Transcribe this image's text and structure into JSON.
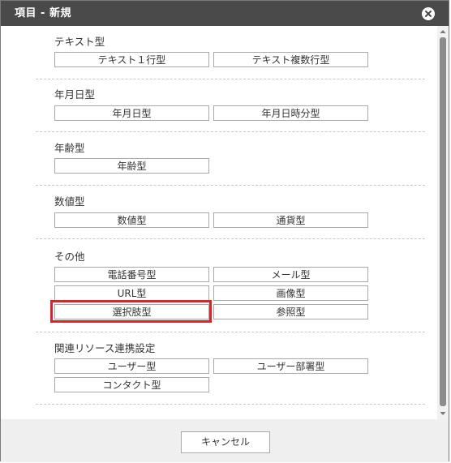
{
  "dialog": {
    "title": "項目 - 新規",
    "close_icon": "close-icon"
  },
  "sections": {
    "text": {
      "title": "テキスト型",
      "buttons": [
        "テキスト１行型",
        "テキスト複数行型"
      ]
    },
    "date": {
      "title": "年月日型",
      "buttons": [
        "年月日型",
        "年月日時分型"
      ]
    },
    "age": {
      "title": "年齢型",
      "buttons": [
        "年齢型"
      ]
    },
    "number": {
      "title": "数値型",
      "buttons": [
        "数値型",
        "通貨型"
      ]
    },
    "other": {
      "title": "その他",
      "buttons": [
        "電話番号型",
        "メール型",
        "URL型",
        "画像型",
        "選択肢型",
        "参照型"
      ]
    },
    "resource": {
      "title": "関連リソース連携設定",
      "buttons": [
        "ユーザー型",
        "ユーザー部署型",
        "コンタクト型"
      ]
    }
  },
  "footer": {
    "cancel_label": "キャンセル"
  },
  "colors": {
    "titlebar": "#4a4a4a",
    "highlight": "#d6262a",
    "footer": "#efefef"
  }
}
